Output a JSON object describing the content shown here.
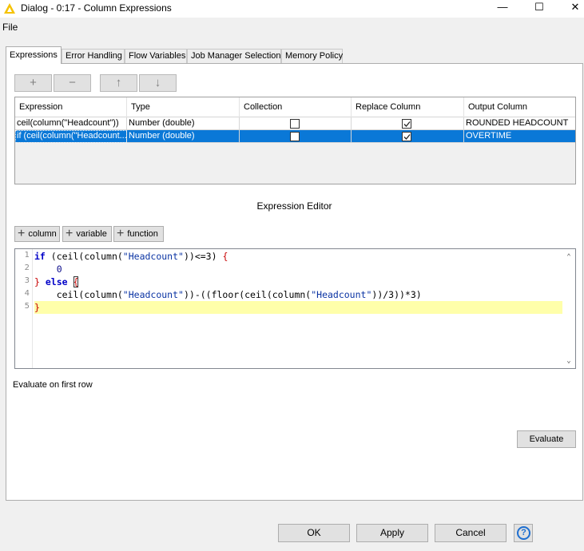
{
  "window": {
    "title": "Dialog - 0:17 - Column Expressions",
    "minimize": "—",
    "maximize": "☐",
    "close": "✕"
  },
  "menu": {
    "file": "File"
  },
  "tabs": [
    {
      "label": "Expressions",
      "active": true
    },
    {
      "label": "Error Handling"
    },
    {
      "label": "Flow Variables"
    },
    {
      "label": "Job Manager Selection"
    },
    {
      "label": "Memory Policy"
    }
  ],
  "toolbar": {
    "add": "+",
    "remove": "−",
    "up": "↑",
    "down": "↓"
  },
  "table": {
    "headers": [
      "Expression",
      "Type",
      "Collection",
      "Replace Column",
      "Output Column"
    ],
    "rows": [
      {
        "expression": "ceil(column(\"Headcount\"))",
        "type": "Number (double)",
        "collection": false,
        "replace": true,
        "output": "ROUNDED HEADCOUNT",
        "selected": false
      },
      {
        "expression": "if (ceil(column(\"Headcount...",
        "type": "Number (double)",
        "collection": false,
        "replace": true,
        "output": "OVERTIME",
        "selected": true
      }
    ]
  },
  "editor": {
    "title": "Expression Editor",
    "buttons": {
      "column": "column",
      "variable": "variable",
      "function": "function"
    },
    "line_numbers": [
      "1",
      "2",
      "3",
      "4",
      "5"
    ],
    "lines": {
      "l1_kw": "if",
      "l1_a": " (ceil(column(",
      "l1_str": "\"Headcount\"",
      "l1_b": "))<=3) ",
      "l1_brace": "{",
      "l2_num": "0",
      "l3_brace": "}",
      "l3_kw": "else",
      "l3_brace2": "{",
      "l4_a": "ceil(column(",
      "l4_str": "\"Headcount\"",
      "l4_b": "))-((floor(ceil(column(",
      "l4_str2": "\"Headcount\"",
      "l4_c": "))/3))*3)",
      "l5_brace": "}"
    }
  },
  "evaluate_label": "Evaluate on first row",
  "evaluate_button": "Evaluate",
  "dialog_buttons": {
    "ok": "OK",
    "apply": "Apply",
    "cancel": "Cancel",
    "help": "?"
  },
  "colors": {
    "selection": "#0a78d7",
    "current_line": "#ffffaa",
    "keyword": "#0000c8",
    "brace": "#c80000",
    "string": "#0a33a3"
  }
}
